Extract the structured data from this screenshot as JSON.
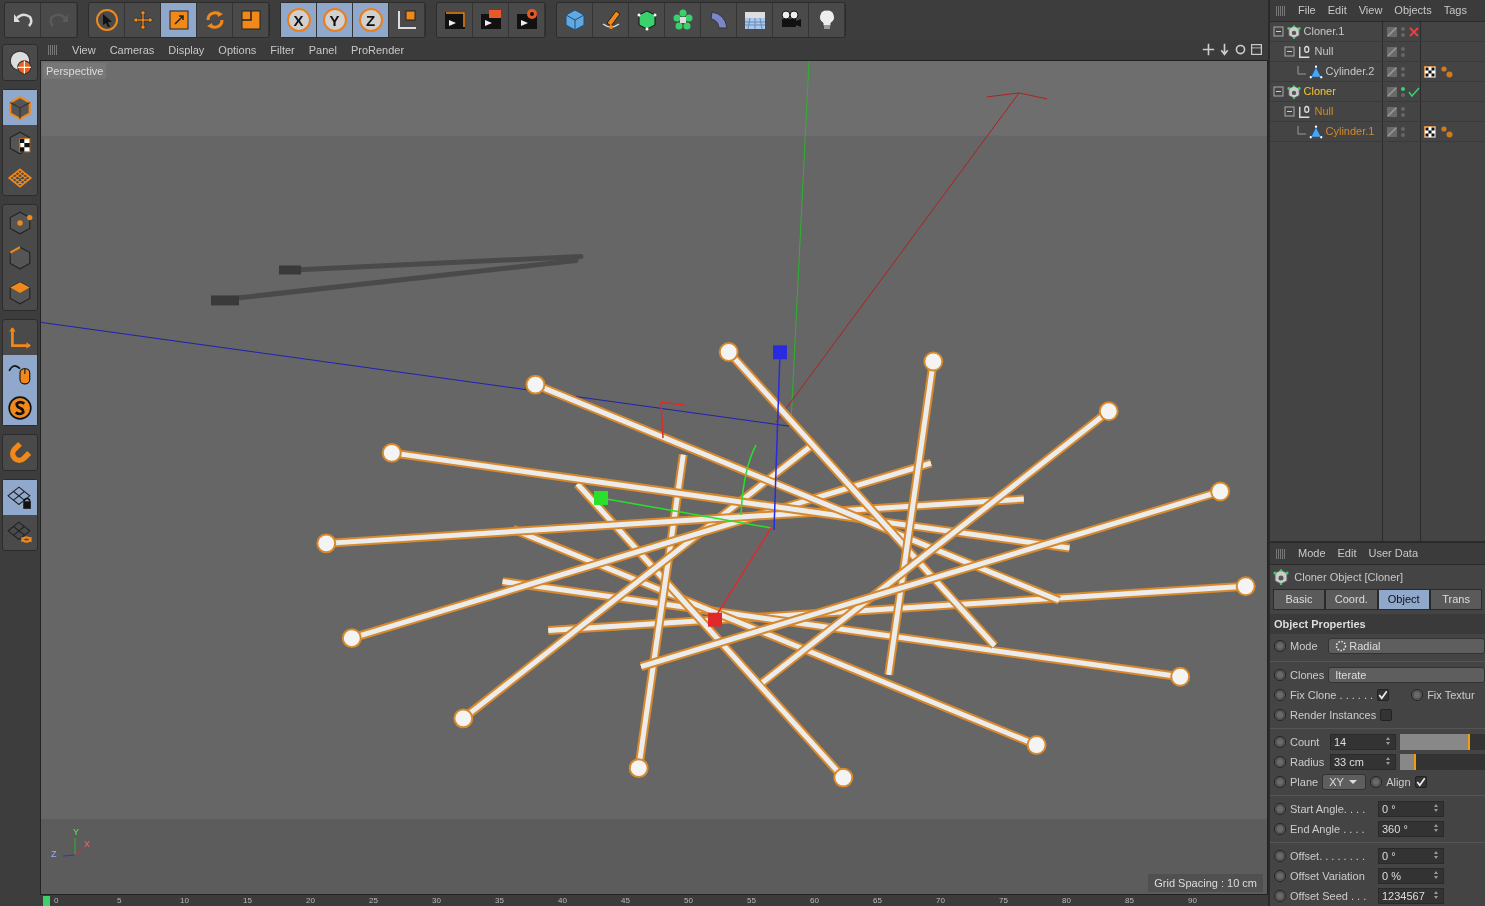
{
  "toolbar": {
    "groups": [
      [
        {
          "kind": "undo",
          "selected": false,
          "disabled": false
        },
        {
          "kind": "redo",
          "selected": false,
          "disabled": true
        }
      ],
      [
        {
          "kind": "select",
          "selected": false,
          "disabled": false
        },
        {
          "kind": "move",
          "selected": false,
          "disabled": false
        },
        {
          "kind": "scale",
          "selected": true,
          "disabled": false
        },
        {
          "kind": "rotate",
          "selected": false,
          "disabled": false
        },
        {
          "kind": "transform",
          "selected": false,
          "disabled": false
        }
      ],
      [
        {
          "kind": "axis",
          "label": "X",
          "selected": true,
          "disabled": false
        },
        {
          "kind": "axis",
          "label": "Y",
          "selected": true,
          "disabled": false
        },
        {
          "kind": "axis",
          "label": "Z",
          "selected": true,
          "disabled": false
        },
        {
          "kind": "coords",
          "selected": false,
          "disabled": false
        }
      ],
      [
        {
          "kind": "clapper",
          "selected": false,
          "disabled": false
        },
        {
          "kind": "clapper-view",
          "selected": false,
          "disabled": false
        },
        {
          "kind": "clapper-gear",
          "selected": false,
          "disabled": false
        }
      ],
      [
        {
          "kind": "cube",
          "selected": false,
          "disabled": false
        },
        {
          "kind": "pen",
          "selected": false,
          "disabled": false
        },
        {
          "kind": "poly-cube",
          "selected": false,
          "disabled": false
        },
        {
          "kind": "flower",
          "selected": false,
          "disabled": false
        },
        {
          "kind": "bend",
          "selected": false,
          "disabled": false
        },
        {
          "kind": "floor",
          "selected": false,
          "disabled": false
        },
        {
          "kind": "camera",
          "selected": false,
          "disabled": false
        },
        {
          "kind": "bulb",
          "selected": false,
          "disabled": false
        }
      ]
    ]
  },
  "left_toolbar": {
    "groups": [
      [
        {
          "kind": "globe",
          "selected": false
        }
      ],
      [
        {
          "kind": "model",
          "selected": true
        },
        {
          "kind": "texture",
          "selected": false
        },
        {
          "kind": "grid",
          "selected": false
        }
      ],
      [
        {
          "kind": "points",
          "selected": false
        },
        {
          "kind": "edges",
          "selected": false
        },
        {
          "kind": "polygons",
          "selected": false
        }
      ],
      [
        {
          "kind": "axis-l",
          "selected": false
        },
        {
          "kind": "mouse",
          "selected": true
        },
        {
          "kind": "snap-s",
          "selected": true
        }
      ],
      [
        {
          "kind": "magnet",
          "selected": false
        }
      ],
      [
        {
          "kind": "grid-lock",
          "selected": true
        },
        {
          "kind": "grid-sync",
          "selected": false
        }
      ]
    ]
  },
  "viewport": {
    "menu": [
      "View",
      "Cameras",
      "Display",
      "Options",
      "Filter",
      "Panel",
      "ProRender"
    ],
    "camera_label": "Perspective",
    "grid_spacing": "Grid Spacing : 10 cm",
    "axis_labels": {
      "y": "Y",
      "x": "X",
      "z": "Z"
    }
  },
  "timeline": {
    "ticks": [
      "0",
      "5",
      "10",
      "15",
      "20",
      "25",
      "30",
      "35",
      "40",
      "45",
      "50",
      "55",
      "60",
      "65",
      "70",
      "75",
      "80",
      "85",
      "90"
    ]
  },
  "object_manager": {
    "menu": [
      "File",
      "Edit",
      "View",
      "Objects",
      "Tags"
    ],
    "objects": [
      {
        "name": "Cloner.1",
        "kind": "cloner",
        "selected": false,
        "expanded": true,
        "enabled": false,
        "children": [
          {
            "name": "Null",
            "kind": "null",
            "selected": false,
            "expanded": true,
            "children": [
              {
                "name": "Cylinder.2",
                "kind": "cylinder",
                "selected": false,
                "tags": [
                  {
                    "kind": "texture"
                  },
                  {
                    "kind": "phong"
                  }
                ]
              }
            ]
          }
        ]
      },
      {
        "name": "Cloner",
        "kind": "cloner",
        "selected": true,
        "expanded": true,
        "enabled": true,
        "children": [
          {
            "name": "Null",
            "kind": "null",
            "selected": false,
            "expanded": true,
            "children": [
              {
                "name": "Cylinder.1",
                "kind": "cylinder",
                "selected": false,
                "tags": [
                  {
                    "kind": "texture"
                  },
                  {
                    "kind": "phong"
                  }
                ]
              }
            ]
          }
        ]
      }
    ]
  },
  "attribute_manager": {
    "menu": [
      "Mode",
      "Edit",
      "User Data"
    ],
    "title": "Cloner Object [Cloner]",
    "tabs": [
      {
        "label": "Basic",
        "selected": false
      },
      {
        "label": "Coord.",
        "selected": false
      },
      {
        "label": "Object",
        "selected": true
      },
      {
        "label": "Trans",
        "selected": false
      }
    ],
    "section": "Object Properties",
    "groups": [
      [
        {
          "kind": "mode",
          "label": "Mode",
          "value": "Radial",
          "keyed": false
        }
      ],
      [
        {
          "kind": "dropdown",
          "label": "Clones",
          "value": "Iterate",
          "keyed": false
        },
        {
          "kind": "check-pair",
          "label": "Fix Clone . . . . . .",
          "checked": true,
          "keyed": false,
          "label2": "Fix Textur",
          "keyed2": false
        },
        {
          "kind": "check",
          "label": "Render Instances",
          "checked": false,
          "keyed": false
        }
      ],
      [
        {
          "kind": "slider",
          "label": "Count",
          "value": "14",
          "level": 0.82,
          "keyed": false
        },
        {
          "kind": "slider",
          "label": "Radius",
          "value": "33 cm",
          "level": 0.19,
          "keyed": false
        },
        {
          "kind": "plane",
          "label": "Plane",
          "value": "XY",
          "keyed": false,
          "label2": "Align",
          "checked": true,
          "keyed2": false
        }
      ],
      [
        {
          "kind": "number",
          "label": "Start Angle. . . .",
          "value": "0 °",
          "keyed": false
        },
        {
          "kind": "number",
          "label": "End Angle . . . .",
          "value": "360 °",
          "keyed": false
        }
      ],
      [
        {
          "kind": "number",
          "label": "Offset. . . . . . . .",
          "value": "0 °",
          "keyed": false
        },
        {
          "kind": "number",
          "label": "Offset Variation",
          "value": "0 %",
          "keyed": false
        },
        {
          "kind": "number",
          "label": "Offset Seed . . .",
          "value": "1234567",
          "keyed": false
        }
      ]
    ]
  }
}
